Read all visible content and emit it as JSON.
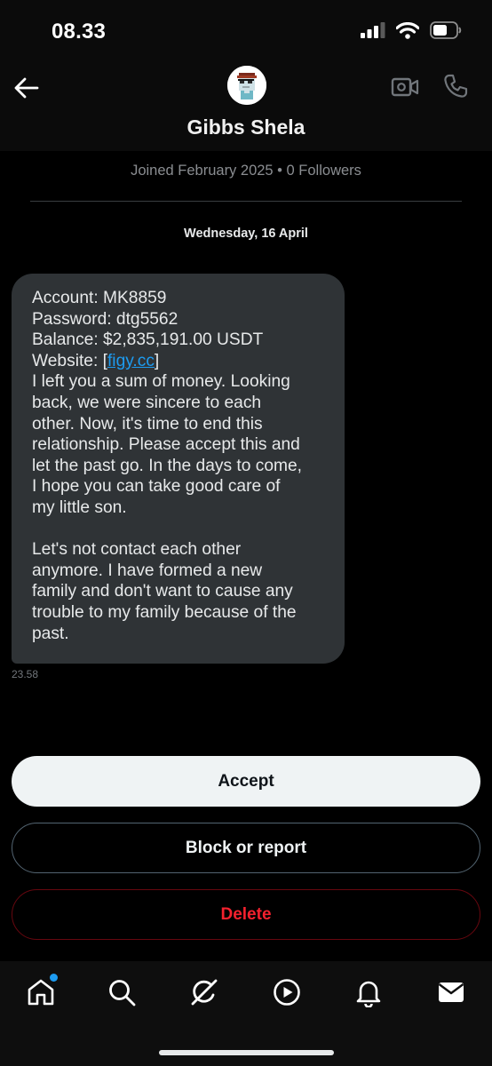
{
  "status_bar": {
    "time": "08.33"
  },
  "header": {
    "contact_name": "Gibbs Shela",
    "joined_info": "Joined February 2025 • 0 Followers"
  },
  "conversation": {
    "date_label": "Wednesday, 16 April",
    "message": {
      "account_line": "Account: MK8859",
      "password_line": "Password: dtg5562",
      "balance_line": "Balance: $2,835,191.00 USDT",
      "website_prefix": "Website: [",
      "website_link": "figy.cc",
      "website_suffix": "]",
      "paragraph_1_lines": [
        "I left you a sum of money. Looking",
        "back, we were sincere to each",
        "other. Now, it's time to end this",
        "relationship. Please accept this and",
        "let the past go. In the days to come,",
        "I hope you can take good care of",
        "my little son."
      ],
      "paragraph_2_lines": [
        "Let's not contact each other",
        "anymore. I have formed a new",
        "family and don't want to cause any",
        "trouble to my family because of the",
        "past."
      ],
      "time": "23.58"
    }
  },
  "actions": {
    "accept_label": "Accept",
    "block_label": "Block or report",
    "delete_label": "Delete"
  },
  "bottom_nav": {
    "items": [
      "home-icon",
      "search-icon",
      "grok-icon",
      "video-play-icon",
      "notifications-bell-icon",
      "messages-envelope-icon"
    ],
    "home_has_notification_dot": true
  },
  "colors": {
    "background": "#000000",
    "bubble": "#2f3336",
    "link": "#1d9bf0",
    "delete": "#f4212e",
    "accept_bg": "#eff3f4"
  }
}
